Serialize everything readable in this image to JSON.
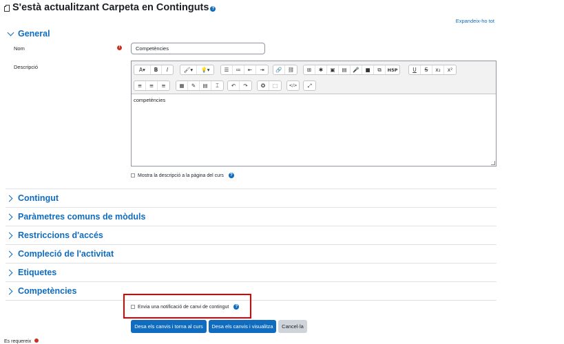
{
  "page_title": "S'està actualitzant Carpeta en Continguts",
  "expand_all": "Expandeix-ho tot",
  "general_section": "General",
  "form": {
    "name_label": "Nom",
    "name_value": "Competències",
    "description_label": "Descripció",
    "description_content": "competències",
    "show_description_label": "Mostra la descripció a la pàgina del curs"
  },
  "sections": [
    {
      "title": "Contingut"
    },
    {
      "title": "Paràmetres comuns de mòduls"
    },
    {
      "title": "Restriccions d'accés"
    },
    {
      "title": "Compleció de l'activitat"
    },
    {
      "title": "Etiquetes"
    },
    {
      "title": "Competències"
    }
  ],
  "notify_label": "Envia una notificació de canvi de contingut",
  "buttons": {
    "save_return": "Desa els canvis i torna al curs",
    "save_display": "Desa els canvis i visualitza",
    "cancel": "Cancel·la"
  },
  "bottom_note": "Es requereix",
  "toolbar": {
    "row1": [
      "A▾",
      "B",
      "I",
      "🖌▾",
      "💡▾",
      "☰",
      "≔",
      "⇤",
      "⇥",
      "🔗",
      "⛓",
      "⊞",
      "✱",
      "▣",
      "▤",
      "🎤",
      "■",
      "⧉",
      "H5P",
      "U",
      "S",
      "x₂",
      "x²"
    ],
    "row2": [
      "≡",
      "≡",
      "≡",
      "▦",
      "✎",
      "▤",
      "⌶",
      "↶",
      "↷",
      "✪",
      "⬚",
      "</>",
      "⤢"
    ]
  },
  "colors": {
    "accent": "#0f6cbf",
    "required": "#ca3120",
    "highlight": "#e00000"
  }
}
